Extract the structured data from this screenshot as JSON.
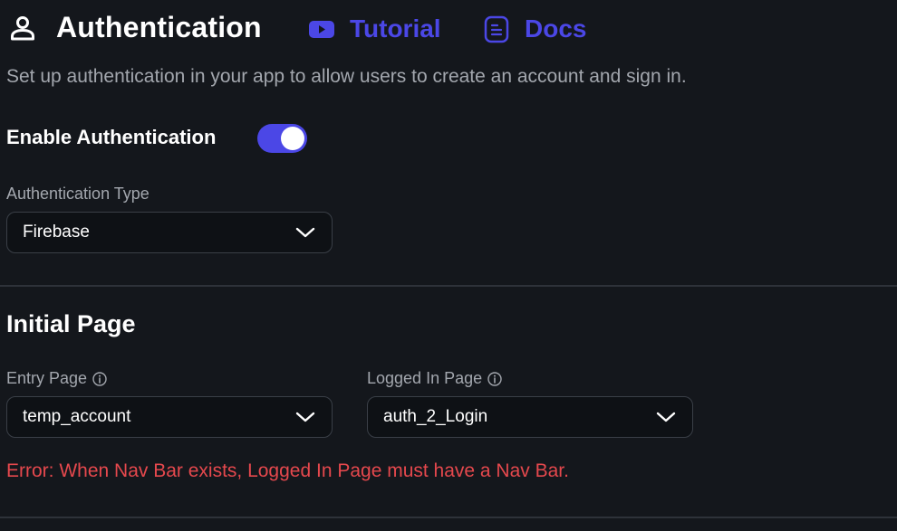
{
  "header": {
    "title": "Authentication",
    "tutorial_label": "Tutorial",
    "docs_label": "Docs",
    "title_icon": "user-icon",
    "tutorial_icon": "youtube-icon",
    "docs_icon": "document-icon"
  },
  "subtitle": "Set up authentication in your app to allow users to create an account and sign in.",
  "enable_auth": {
    "label": "Enable Authentication",
    "enabled": true
  },
  "auth_type": {
    "label": "Authentication Type",
    "value": "Firebase"
  },
  "initial_page": {
    "section_title": "Initial Page",
    "entry_page": {
      "label": "Entry Page",
      "value": "temp_account"
    },
    "logged_in_page": {
      "label": "Logged In Page",
      "value": "auth_2_Login"
    },
    "error": "Error: When Nav Bar exists, Logged In Page must have a Nav Bar."
  },
  "colors": {
    "background": "#14171c",
    "accent": "#4b47e6",
    "muted_text": "#a3a7ae",
    "error": "#e5484d",
    "field_background": "#0e1115",
    "border": "#3a3f47"
  }
}
